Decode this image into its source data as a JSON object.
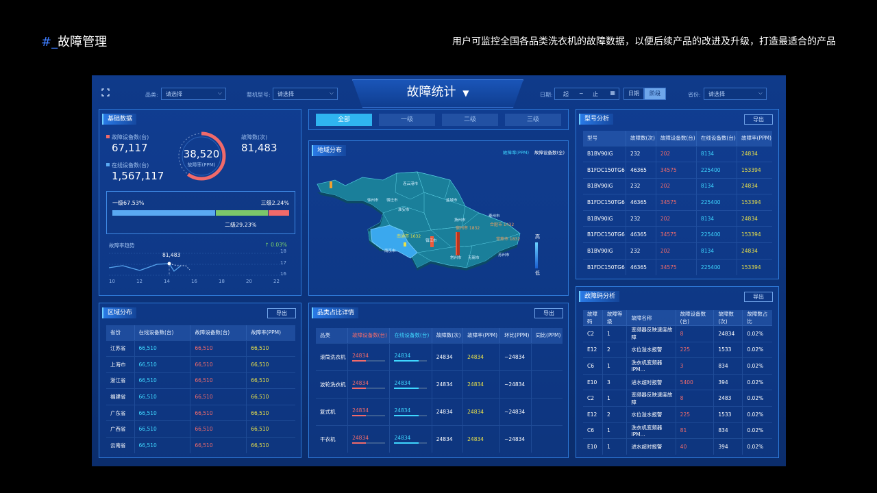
{
  "page": {
    "heading_hash": "#_",
    "heading": "故障管理",
    "description": "用户可监控全国各品类洗衣机的故障数据，以便后续产品的改进及升级，打造最适合的产品"
  },
  "topbar": {
    "title": "故障统计",
    "category_label": "品类:",
    "category_placeholder": "请选择",
    "model_label": "整机型号:",
    "model_placeholder": "请选择",
    "date_label": "日期:",
    "date_start": "起",
    "date_sep": "~",
    "date_end": "止",
    "btn_day": "日期",
    "btn_period": "阶段",
    "province_label": "省份:",
    "province_placeholder": "请选择"
  },
  "basic": {
    "title": "基础数据",
    "fault_devices_label": "故障设备数(台)",
    "fault_devices": "67,117",
    "fault_count_label": "故障数(次)",
    "fault_count": "81,483",
    "online_devices_label": "在线设备数(台)",
    "online_devices": "1,567,117",
    "gauge_value": "38,520",
    "gauge_label": "故障率(PPM)",
    "gauge_fraction": 0.6,
    "level1_label": "一级67.53%",
    "level2_label": "二级29.23%",
    "level3_label": "三级2.24%",
    "level1": 67.53,
    "level2": 29.23,
    "level3": 2.24,
    "trend_label": "故障率趋势",
    "trend_change": "↑ 0.03%",
    "trend_point_label": "81,483",
    "trend_x": [
      "10",
      "12",
      "14",
      "16",
      "18",
      "20",
      "22"
    ],
    "trend_y": [
      "18",
      "17",
      "16"
    ]
  },
  "colors": {
    "level1": "#5aa9f2",
    "level2": "#7cc76a",
    "level3": "#f06a6a",
    "accent": "#3fd7ff"
  },
  "level_tabs": [
    "全部",
    "一级",
    "二级",
    "三级"
  ],
  "map": {
    "title": "地域分布",
    "legend1": "故障率(PPM)",
    "legend2": "故障设备数(全)",
    "scale_high": "高",
    "scale_low": "低",
    "label1": "宿州市 1832",
    "label2": "合肥市 1432",
    "label3": "常熟市 1832",
    "label4": "南通市 1632",
    "cities": [
      "连云港市",
      "宿迁市",
      "淮安市",
      "盐城市",
      "徐州市",
      "扬州市",
      "泰州市",
      "南京市",
      "镇江市",
      "常州市",
      "无锡市",
      "苏州市"
    ]
  },
  "region": {
    "title": "区域分布",
    "export": "导出",
    "headers": [
      "省份",
      "在线设备数(台)",
      "故障设备数(台)",
      "故障率(PPM)"
    ],
    "rows": [
      [
        "江苏省",
        "66,510",
        "66,510",
        "66,510"
      ],
      [
        "上海市",
        "66,510",
        "66,510",
        "66,510"
      ],
      [
        "浙江省",
        "66,510",
        "66,510",
        "66,510"
      ],
      [
        "福建省",
        "66,510",
        "66,510",
        "66,510"
      ],
      [
        "广东省",
        "66,510",
        "66,510",
        "66,510"
      ],
      [
        "广西省",
        "66,510",
        "66,510",
        "66,510"
      ],
      [
        "云南省",
        "66,510",
        "66,510",
        "66,510"
      ]
    ]
  },
  "category": {
    "title": "品类占比详情",
    "export": "导出",
    "headers": [
      "品类",
      "故障设备数(台)",
      "在线设备数(台)",
      "故障数(次)",
      "故障率(PPM)",
      "环比(PPM)",
      "同比(PPM)"
    ],
    "rows": [
      [
        "滚筒洗衣机",
        "24834",
        "24834",
        "24834",
        "24834",
        "~24834",
        ""
      ],
      [
        "波轮洗衣机",
        "24834",
        "24834",
        "24834",
        "24834",
        "~24834",
        ""
      ],
      [
        "复式机",
        "24834",
        "24834",
        "24834",
        "24834",
        "~24834",
        ""
      ],
      [
        "干衣机",
        "24834",
        "24834",
        "24834",
        "24834",
        "~24834",
        ""
      ]
    ]
  },
  "model": {
    "title": "型号分析",
    "export": "导出",
    "headers": [
      "型号",
      "故障数(次)",
      "故障设备数(台)",
      "在线设备数(台)",
      "故障率(PPM)"
    ],
    "rows": [
      [
        "B1BV90IG",
        "232",
        "202",
        "8134",
        "24834"
      ],
      [
        "B1FDC150TG6",
        "46365",
        "34575",
        "225400",
        "153394"
      ],
      [
        "B1BV90IG",
        "232",
        "202",
        "8134",
        "24834"
      ],
      [
        "B1FDC150TG6",
        "46365",
        "34575",
        "225400",
        "153394"
      ],
      [
        "B1BV90IG",
        "232",
        "202",
        "8134",
        "24834"
      ],
      [
        "B1FDC150TG6",
        "46365",
        "34575",
        "225400",
        "153394"
      ],
      [
        "B1BV90IG",
        "232",
        "202",
        "8134",
        "24834"
      ],
      [
        "B1FDC150TG6",
        "46365",
        "34575",
        "225400",
        "153394"
      ]
    ]
  },
  "faultcode": {
    "title": "故障码分析",
    "export": "导出",
    "headers": [
      "故障码",
      "故障等级",
      "故障名称",
      "故障设备数(台)",
      "故障数(次)",
      "故障数占比"
    ],
    "rows": [
      [
        "C2",
        "1",
        "变频器反映速度故障",
        "8",
        "24834",
        "0.02%"
      ],
      [
        "E12",
        "2",
        "水位溢水报警",
        "225",
        "1533",
        "0.02%"
      ],
      [
        "C6",
        "1",
        "洗衣机变频器IPM...",
        "3",
        "834",
        "0.02%"
      ],
      [
        "E10",
        "3",
        "进水超时报警",
        "5400",
        "394",
        "0.02%"
      ],
      [
        "C2",
        "1",
        "变频器反映速度故障",
        "8",
        "2483",
        "0.02%"
      ],
      [
        "E12",
        "2",
        "水位溢水报警",
        "225",
        "1533",
        "0.02%"
      ],
      [
        "C6",
        "1",
        "洗衣机变频器IPM...",
        "81",
        "834",
        "0.02%"
      ],
      [
        "E10",
        "1",
        "进水超时报警",
        "40",
        "394",
        "0.02%"
      ]
    ]
  }
}
